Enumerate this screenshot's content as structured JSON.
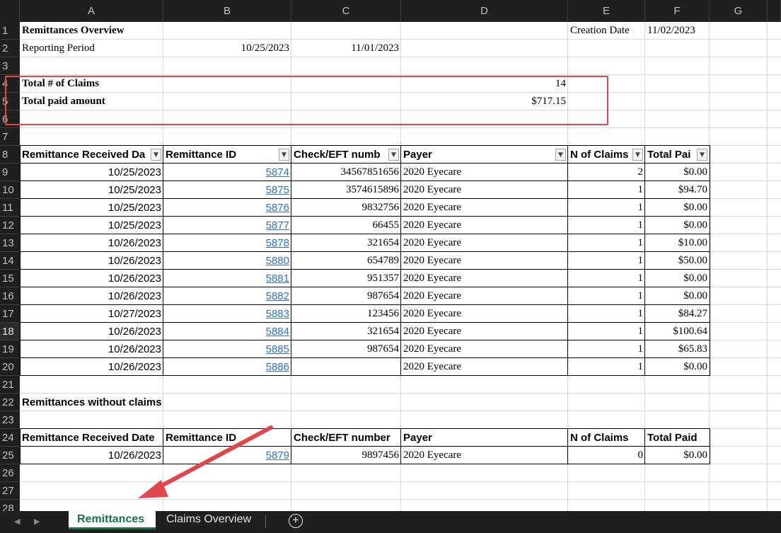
{
  "column_headers": [
    "A",
    "B",
    "C",
    "D",
    "E",
    "F",
    "G"
  ],
  "row_headers": [
    "1",
    "2",
    "3",
    "4",
    "5",
    "6",
    "7",
    "8",
    "9",
    "10",
    "11",
    "12",
    "13",
    "14",
    "15",
    "16",
    "17",
    "18",
    "19",
    "20",
    "21",
    "22",
    "23",
    "24",
    "25",
    "26",
    "27",
    "28"
  ],
  "selected_row": "18",
  "overview": {
    "title": "Remittances Overview",
    "creation_label": "Creation Date",
    "creation_date": "11/02/2023",
    "period_label": "Reporting Period",
    "period_start": "10/25/2023",
    "period_end": "11/01/2023",
    "total_claims_label": "Total # of Claims",
    "total_claims": "14",
    "total_paid_label": "Total paid amount",
    "total_paid": "$717.15"
  },
  "table1": {
    "headers": [
      "Remittance Received Da",
      "Remittance ID",
      "Check/EFT numb",
      "Payer",
      "N of Claims",
      "Total Pai"
    ],
    "rows": [
      [
        "10/25/2023",
        "5874",
        "34567851656",
        "2020 Eyecare",
        "2",
        "$0.00"
      ],
      [
        "10/25/2023",
        "5875",
        "3574615896",
        "2020 Eyecare",
        "1",
        "$94.70"
      ],
      [
        "10/25/2023",
        "5876",
        "9832756",
        "2020 Eyecare",
        "1",
        "$0.00"
      ],
      [
        "10/25/2023",
        "5877",
        "66455",
        "2020 Eyecare",
        "1",
        "$0.00"
      ],
      [
        "10/26/2023",
        "5878",
        "321654",
        "2020 Eyecare",
        "1",
        "$10.00"
      ],
      [
        "10/26/2023",
        "5880",
        "654789",
        "2020 Eyecare",
        "1",
        "$50.00"
      ],
      [
        "10/26/2023",
        "5881",
        "951357",
        "2020 Eyecare",
        "1",
        "$0.00"
      ],
      [
        "10/26/2023",
        "5882",
        "987654",
        "2020 Eyecare",
        "1",
        "$0.00"
      ],
      [
        "10/27/2023",
        "5883",
        "123456",
        "2020 Eyecare",
        "1",
        "$84.27"
      ],
      [
        "10/26/2023",
        "5884",
        "321654",
        "2020 Eyecare",
        "1",
        "$100.64"
      ],
      [
        "10/26/2023",
        "5885",
        "987654",
        "2020 Eyecare",
        "1",
        "$65.83"
      ],
      [
        "10/26/2023",
        "5886",
        "",
        "2020 Eyecare",
        "1",
        "$0.00"
      ]
    ]
  },
  "section2_title": "Remittances without claims",
  "table2": {
    "headers": [
      "Remittance Received Date",
      "Remittance ID",
      "Check/EFT number",
      "Payer",
      "N of Claims",
      "Total Paid"
    ],
    "rows": [
      [
        "10/26/2023",
        "5879",
        "9897456",
        "2020 Eyecare",
        "0",
        "$0.00"
      ]
    ]
  },
  "tabs": [
    {
      "label": "Remittances",
      "active": true
    },
    {
      "label": "Claims Overview",
      "active": false
    }
  ],
  "tab_nav": {
    "prev": "◀",
    "next": "▶",
    "add": "+"
  },
  "colors": {
    "accent_green": "#1e7145",
    "highlight_red": "#e0474c",
    "link_blue": "#2e6fd1"
  }
}
